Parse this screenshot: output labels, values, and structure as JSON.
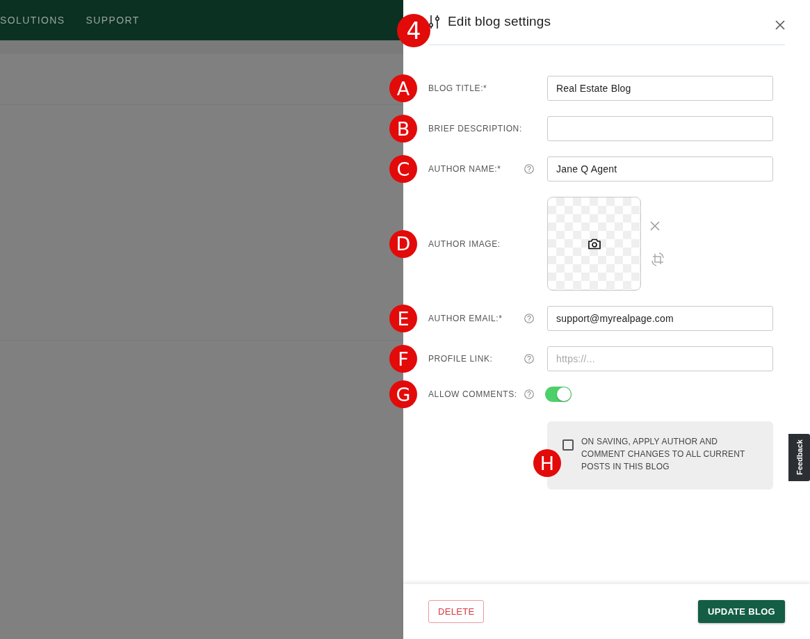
{
  "nav": {
    "items": [
      "SOLUTIONS",
      "SUPPORT"
    ]
  },
  "dialog": {
    "marker": "4",
    "title": "Edit blog settings",
    "fields": [
      {
        "kind": "text",
        "marker": "A",
        "label": "BLOG TITLE:*",
        "help": false,
        "value": "Real Estate Blog"
      },
      {
        "kind": "text",
        "marker": "B",
        "label": "BRIEF DESCRIPTION:",
        "help": false
      },
      {
        "kind": "text",
        "marker": "C",
        "label": "AUTHOR NAME:*",
        "help": true,
        "value": "Jane Q Agent"
      },
      {
        "kind": "image",
        "marker": "D",
        "label": "AUTHOR IMAGE:",
        "help": false
      },
      {
        "kind": "text",
        "marker": "E",
        "label": "AUTHOR EMAIL:*",
        "help": true,
        "value": "support@myrealpage.com"
      },
      {
        "kind": "text",
        "marker": "F",
        "label": "PROFILE LINK:",
        "help": true,
        "placeholder": "https://..."
      },
      {
        "kind": "toggle",
        "marker": "G",
        "label": "ALLOW COMMENTS:",
        "help": true,
        "on": true
      }
    ],
    "apply_option": {
      "marker": "H",
      "label": "ON SAVING, APPLY AUTHOR AND COMMENT CHANGES TO ALL CURRENT POSTS IN THIS BLOG",
      "checked": false
    },
    "buttons": [
      {
        "kind": "danger",
        "label": "DELETE"
      },
      {
        "kind": "primary",
        "label": "UPDATE BLOG"
      }
    ]
  },
  "feedback_tab": {
    "label": "Feedback"
  }
}
